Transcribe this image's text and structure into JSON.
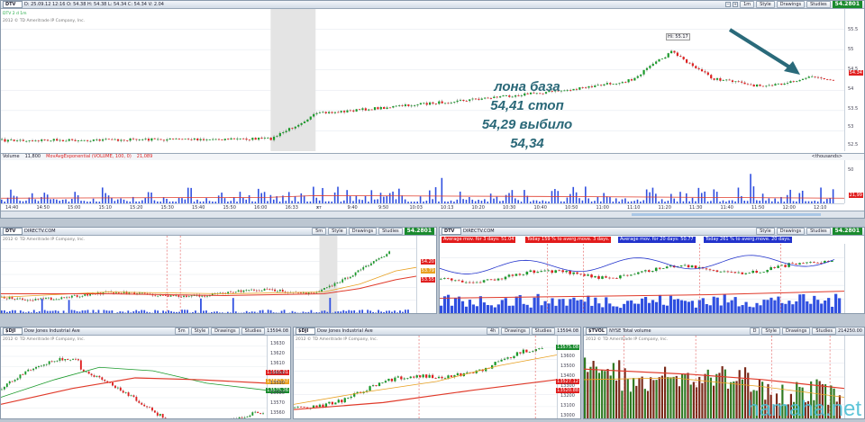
{
  "main": {
    "symbol": "DTV",
    "interval": "DTV 2 d 1m",
    "ohlc": "D: 25.09.12 12:16  O: 54.38  H: 54.38  L: 54.34  C: 54.34  V: 2.04",
    "info": "2012 © TD Ameritrade IP Company, Inc.",
    "hi_label": "Hi: 55.17",
    "price": "54.2801",
    "price_tag": "54.34",
    "y_ticks": [
      "55.5",
      "55",
      "54.5",
      "54",
      "53.5",
      "53",
      "52.5"
    ],
    "volume_label": "Volume",
    "volume_value": "11,800",
    "ema_label": "MovAvgExponential (VOLUME, 100, 0)",
    "ema_value": "21,089",
    "thousands": "<thousands>",
    "vol_ticks": [
      "50",
      "21,99"
    ],
    "x_ticks": [
      "14:40",
      "14:50",
      "15:00",
      "15:10",
      "15:20",
      "15:30",
      "15:40",
      "15:50",
      "16:00",
      "16:33",
      "ѫт",
      "9:40",
      "9:50",
      "10:03",
      "10:13",
      "10:20",
      "10:30",
      "10:40",
      "10:50",
      "11:00",
      "11:10",
      "11:20",
      "11:30",
      "11:40",
      "11:50",
      "12:00",
      "12:10"
    ],
    "toolbar": {
      "interval_btn": "1m",
      "style": "Style",
      "drawings": "Drawings",
      "studies": "Studies"
    }
  },
  "annotation": {
    "lines": [
      "лона база",
      "54,41 стоп",
      "54,29 выбило",
      "54,34"
    ]
  },
  "mid_left": {
    "symbol": "DTV",
    "title": "DIRECTV.COM",
    "interval_btn": "5m",
    "price": "54.2801",
    "info": "2012 © TD Ameritrade IP Company, Inc.",
    "tags": [
      "54.20",
      "53.79",
      "53.55"
    ]
  },
  "mid_right": {
    "symbol": "DTV",
    "title": "DIRECTV.COM",
    "price": "54.2801",
    "legends": [
      {
        "text": "Average mov. for 3 days: 51.04",
        "color": "#e21b1b"
      },
      {
        "text": "Today 159 % to averg.move. 3 days.",
        "color": "#e21b1b"
      },
      {
        "text": "Average mov. for 20 days: 50.77",
        "color": "#2233cc"
      },
      {
        "text": "Today 261 % to averg.move. 20 days.",
        "color": "#2233cc"
      }
    ]
  },
  "bottom_1": {
    "symbol": "$DJI",
    "title": "Dow Jones Industrial Ave",
    "interval_btn": "5m",
    "price": "13594.08",
    "change": "+20.14",
    "info": "2012 © TD Ameritrade IP Company, Inc.",
    "ticks": [
      "13630",
      "13620",
      "13610",
      "13600",
      "13590",
      "13580",
      "13570",
      "13560"
    ],
    "tags": [
      "13585.81",
      "13582.37",
      "13575.26"
    ]
  },
  "bottom_2": {
    "symbol": "$DJI",
    "title": "Dow Jones Industrial Ave",
    "interval_btn": "4h",
    "price": "13594.08",
    "info": "2012 © TD Ameritrade IP Company, Inc.",
    "ticks": [
      "13600",
      "13500",
      "13400",
      "13300",
      "13200",
      "13100",
      "13000"
    ],
    "tags": [
      "13575.08",
      "13527.12",
      "13520.88"
    ]
  },
  "bottom_3": {
    "symbol": "$TVOL",
    "title": "NYSE Total volume",
    "interval_btn": "D",
    "price": "214250.00",
    "info": "2012 © TD Ameritrade IP Company, Inc."
  },
  "watermark": "hamaha.net",
  "colors": {
    "up": "#1a9a2a",
    "down": "#e02020",
    "ema": "#e03a2a",
    "volume": "#2f4fe0",
    "price_bg": "#1a8b2e"
  }
}
